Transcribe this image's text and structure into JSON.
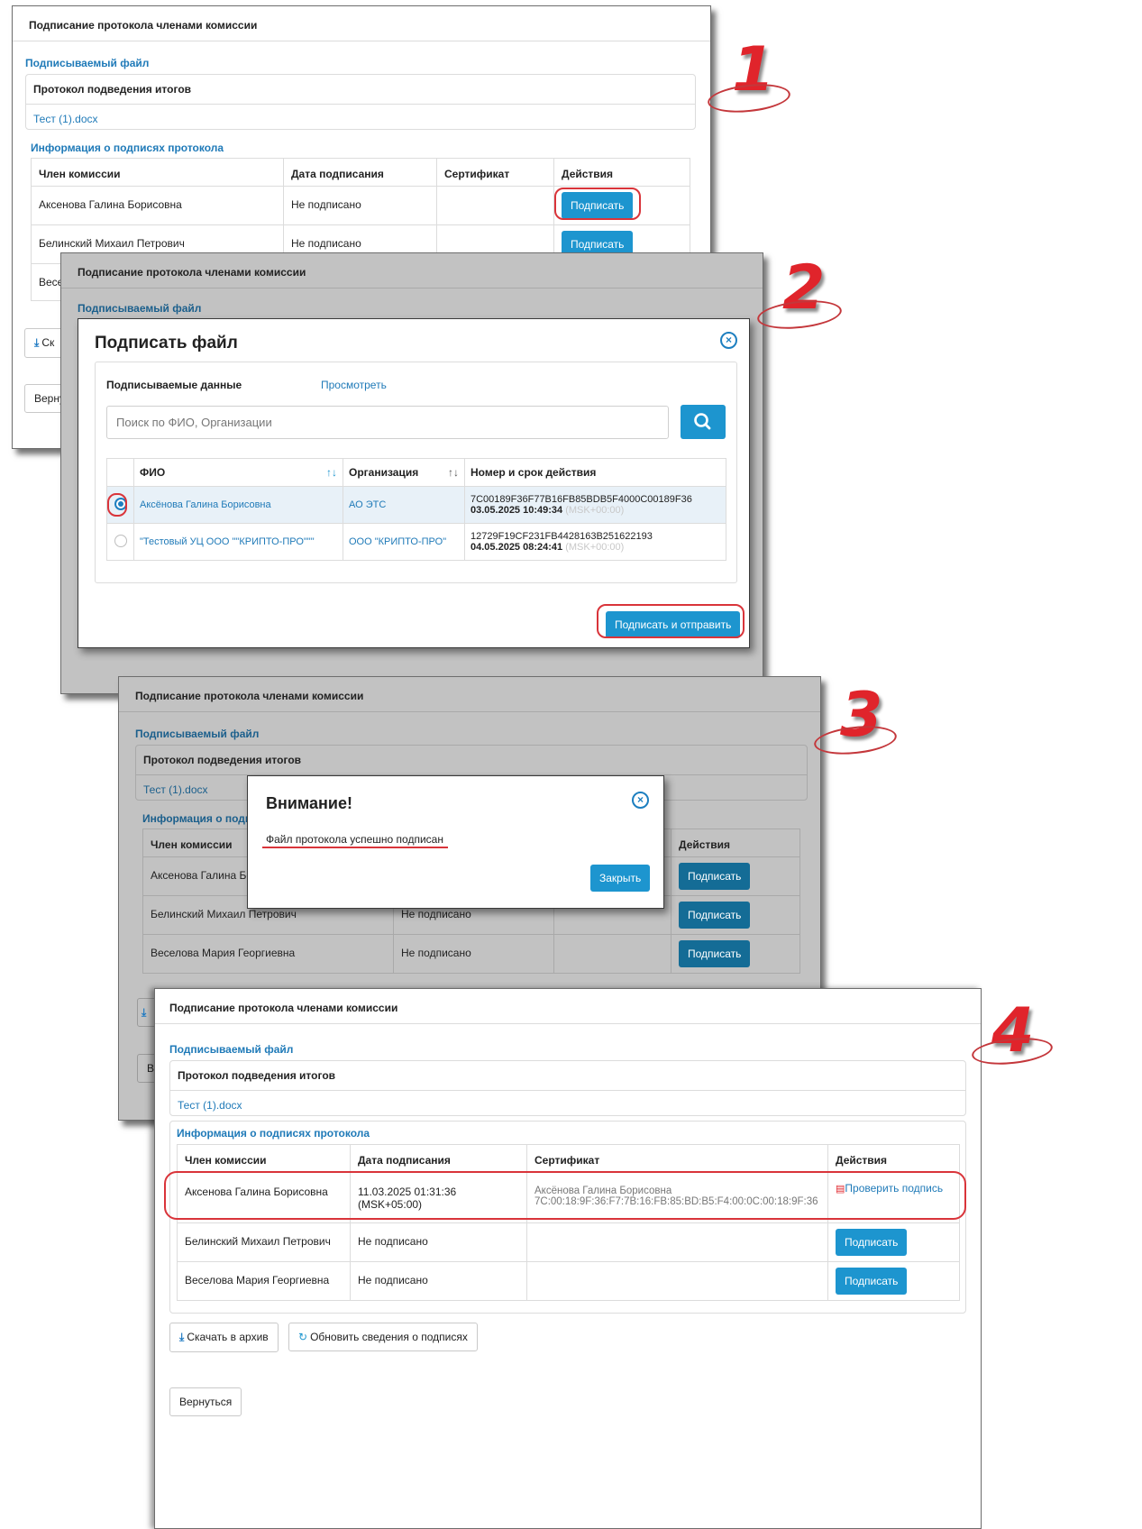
{
  "steps": [
    "1",
    "2",
    "3",
    "4"
  ],
  "panel": {
    "title": "Подписание протокола членами комиссии",
    "file_section": "Подписываемый файл",
    "file_header": "Протокол подведения итогов",
    "file_name": "Тест (1).docx",
    "sign_section": "Информация о подписях протокола",
    "columns": {
      "member": "Член комиссии",
      "date": "Дата подписания",
      "cert": "Сертификат",
      "actions": "Действия"
    },
    "members": [
      "Аксенова Галина Борисовна",
      "Белинский Михаил Петрович",
      "Веселова Мария Георгиевна"
    ],
    "not_signed": "Не подписано",
    "sign_btn": "Подписать",
    "download_btn": "Скачать в архив",
    "refresh_btn": "Обновить сведения о подписях",
    "back_btn": "Вернуться"
  },
  "partial": {
    "row3_name": "Весе",
    "download": "Ск",
    "back": "Верну",
    "be": "Ве",
    "members_cut": "Аксенова Галина Бо",
    "row2_cut": "Белинский Михаил Петрович",
    "info_cut": "Информация о подпи"
  },
  "sign_modal": {
    "title": "Подписать файл",
    "data_label": "Подписываемые данные",
    "view_link": "Просмотреть",
    "search_placeholder": "Поиск по ФИО, Организации",
    "col_fio": "ФИО",
    "col_org": "Организация",
    "col_num": "Номер и срок действия",
    "certs": [
      {
        "fio": "Аксёнова Галина Борисовна",
        "org": "АО ЭТС",
        "num": "7C00189F36F77B16FB85BDB5F4000C00189F36",
        "date": "03.05.2025 10:49:34",
        "tz": "(MSK+00:00)"
      },
      {
        "fio": "\"Тестовый УЦ ООО \"\"КРИПТО-ПРО\"\"\"",
        "org": "ООО \"КРИПТО-ПРО\"",
        "num": "12729F19CF231FB4428163B251622193",
        "date": "04.05.2025 08:24:41",
        "tz": "(MSK+00:00)"
      }
    ],
    "submit": "Подписать и отправить"
  },
  "alert_modal": {
    "title": "Внимание!",
    "message": "Файл протокола успешно подписан",
    "close": "Закрыть"
  },
  "final": {
    "signed_date": "11.03.2025 01:31:36 (MSK+05:00)",
    "cert_name": "Аксёнова Галина Борисовна",
    "cert_num": "7C:00:18:9F:36:F7:7B:16:FB:85:BD:B5:F4:00:0C:00:18:9F:36",
    "verify": "Проверить подпись"
  },
  "colors": {
    "accent": "#1d95cf",
    "link": "#1f7ab8",
    "annotation_red": "#e0242b"
  }
}
